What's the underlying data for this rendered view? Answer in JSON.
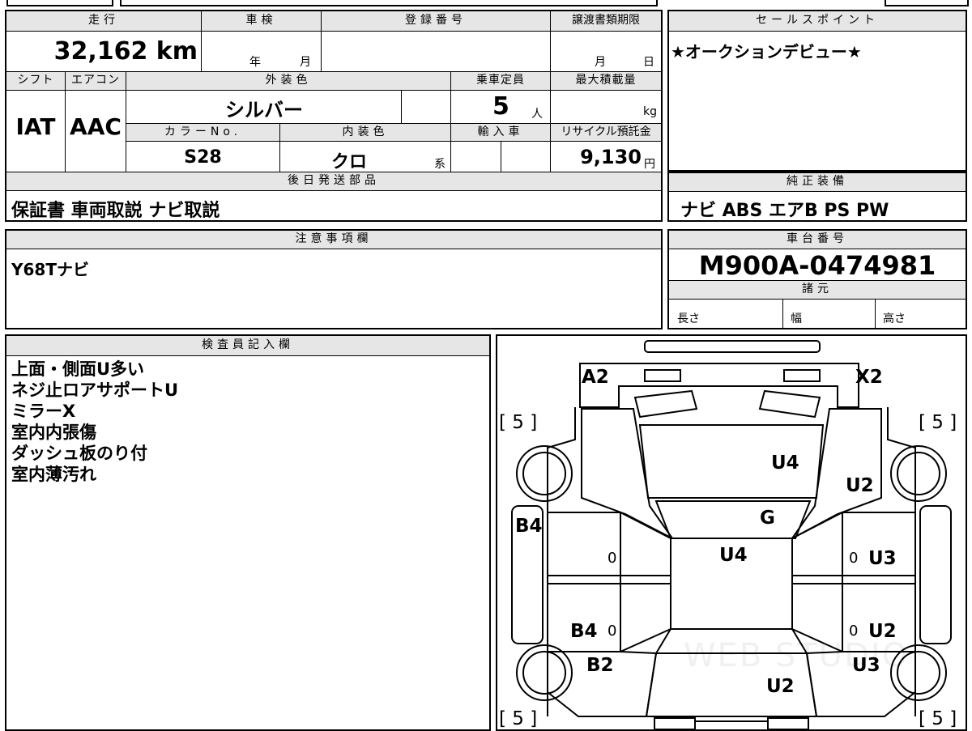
{
  "header": {
    "mileage_label": "走行",
    "inspection_label": "車検",
    "registration_label": "登録番号",
    "transfer_deadline_label": "譲渡書類期限",
    "sales_point_label": "セールスポイント"
  },
  "values": {
    "mileage": "32,162 km",
    "inspection_year": "年",
    "inspection_month": "月",
    "transfer_month": "月",
    "transfer_day": "日",
    "sales_point": "★オークションデビュー★"
  },
  "row2": {
    "shift_label": "シフト",
    "aircon_label": "エアコン",
    "exterior_label": "外装色",
    "capacity_label": "乗車定員",
    "max_load_label": "最大積載量",
    "shift": "IAT",
    "aircon": "AAC",
    "exterior_color": "シルバー",
    "capacity": "5",
    "capacity_unit": "人",
    "max_load_unit": "kg",
    "color_no_label": "カラーNo.",
    "interior_label": "内装色",
    "import_label": "輸入車",
    "recycle_label": "リサイクル預託金",
    "color_no": "S28",
    "interior_color": "クロ",
    "interior_suffix": "系",
    "recycle_fee": "9,130",
    "recycle_unit": "円"
  },
  "shipping": {
    "label": "後日発送部品",
    "items": "保証書 車両取説 ナビ取説"
  },
  "equipment": {
    "label": "純正装備",
    "items": "ナビ ABS エアB PS PW"
  },
  "notes": {
    "label": "注意事項欄",
    "text": "Y68Tナビ"
  },
  "chassis": {
    "label": "車台番号",
    "number": "M900A-0474981",
    "specs_label": "諸元",
    "length_label": "長さ",
    "width_label": "幅",
    "height_label": "高さ"
  },
  "inspector": {
    "label": "検査員記入欄",
    "lines": [
      "上面・側面U多い",
      "ネジ止ロアサポートU",
      "ミラーX",
      "室内内張傷",
      "ダッシュ板のり付",
      "室内薄汚れ"
    ]
  },
  "diagram": {
    "tire_fl": "[ 5 ]",
    "tire_fr": "[ 5 ]",
    "tire_rl": "[ 5 ]",
    "tire_rr": "[ 5 ]",
    "a2": "A2",
    "x2": "X2",
    "u4_hood": "U4",
    "u2_fender_r": "U2",
    "g_windshield": "G",
    "b4_front_left": "B4",
    "u4_roof": "U4",
    "zero_1": "0",
    "zero_2": "0",
    "u3_front_door_r": "U3",
    "b4_rear_left": "B4",
    "zero_3": "0",
    "zero_4": "0",
    "u2_rear_door_r": "U2",
    "b2_rear_left": "B2",
    "u3_rear_r": "U3",
    "u2_rear": "U2",
    "watermark": "WEB STUDIO"
  }
}
